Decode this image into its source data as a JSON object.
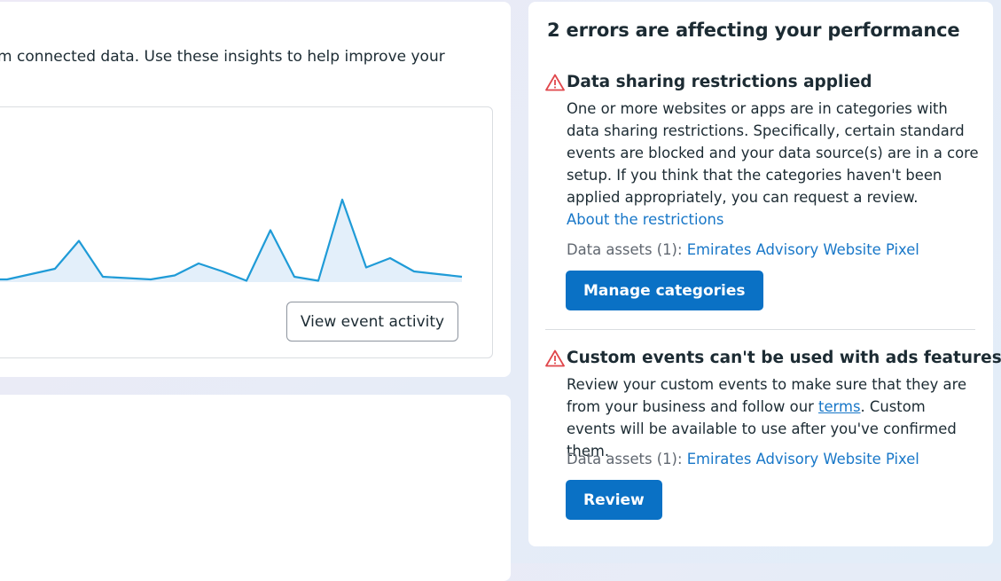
{
  "left_card": {
    "intro_text": "rom connected data. Use these insights to help improve your",
    "view_event_button": "View event activity"
  },
  "chart_data": {
    "type": "area",
    "values": [
      2,
      2,
      6,
      10,
      31,
      4,
      3,
      2,
      5,
      14,
      8,
      1,
      39,
      4,
      1,
      62,
      11,
      18,
      8,
      6,
      4
    ],
    "ylim": [
      0,
      100
    ],
    "series_color": "#1f9bd7",
    "fill_color": "#e3effa"
  },
  "errors_panel": {
    "title": "2 errors are affecting your performance",
    "errors": [
      {
        "title": "Data sharing restrictions applied",
        "body": "One or more websites or apps are in categories with data sharing restrictions. Specifically, certain standard events are blocked and your data source(s) are in a core setup. If you think that the categories haven't been applied appropriately, you can request a review.",
        "link": "About the restrictions",
        "assets_label": "Data assets (1): ",
        "asset_name": "Emirates Advisory Website Pixel",
        "button": "Manage categories"
      },
      {
        "title": "Custom events can't be used with ads features",
        "body_before": "Review your custom events to make sure that they are from your business and follow our ",
        "body_link": "terms",
        "body_after": ". Custom events will be available to use after you've confirmed them.",
        "assets_label": "Data assets (1): ",
        "asset_name": "Emirates Advisory Website Pixel",
        "button": "Review"
      }
    ],
    "warning_color": "#e0464b"
  }
}
